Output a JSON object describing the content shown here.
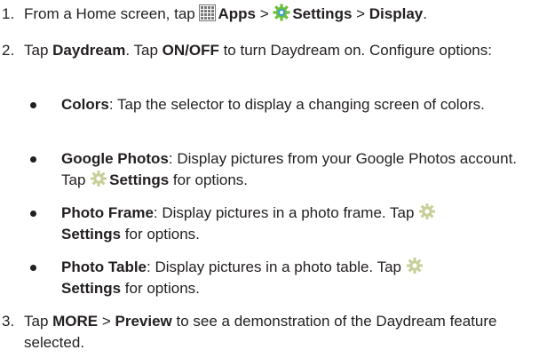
{
  "steps": [
    {
      "num": "1.",
      "t1": "From a Home screen, tap ",
      "apps": "Apps",
      "sep1": " > ",
      "settings": "Settings",
      "sep2": " > ",
      "display": "Display",
      "end": "."
    },
    {
      "num": "2.",
      "t1": "Tap ",
      "daydream": "Daydream",
      "t2": ". Tap ",
      "onoff": "ON/OFF",
      "t3": " to turn Daydream on. Configure options:"
    },
    {
      "num": "3.",
      "t1": "Tap ",
      "more": "MORE",
      "sep": " > ",
      "preview": "Preview",
      "t2": " to see a demonstration of the Daydream feature selected."
    }
  ],
  "bullets": [
    {
      "term": "Colors",
      "text": ": Tap the selector to display a changing screen of colors."
    },
    {
      "term": "Google Photos",
      "text": ": Display pictures from your Google Photos account. Tap ",
      "settings": "Settings",
      "after": " for options."
    },
    {
      "term": "Photo Frame",
      "text": ": Display pictures in a photo frame. Tap ",
      "settings": "Settings",
      "after": " for options."
    },
    {
      "term": "Photo Table",
      "text": ": Display pictures in a photo table. Tap ",
      "settings": "Settings",
      "after": " for options."
    }
  ],
  "colors": {
    "text": "#231f20",
    "apps_icon": "#7a7a7a",
    "settings_icon_gear": "#6bbf3a",
    "settings_icon_center": "#3b9fd6",
    "settings_inline_gear": "#c9cf9a"
  },
  "icons": {
    "apps": "apps-grid-icon",
    "settings": "settings-gear-icon"
  }
}
